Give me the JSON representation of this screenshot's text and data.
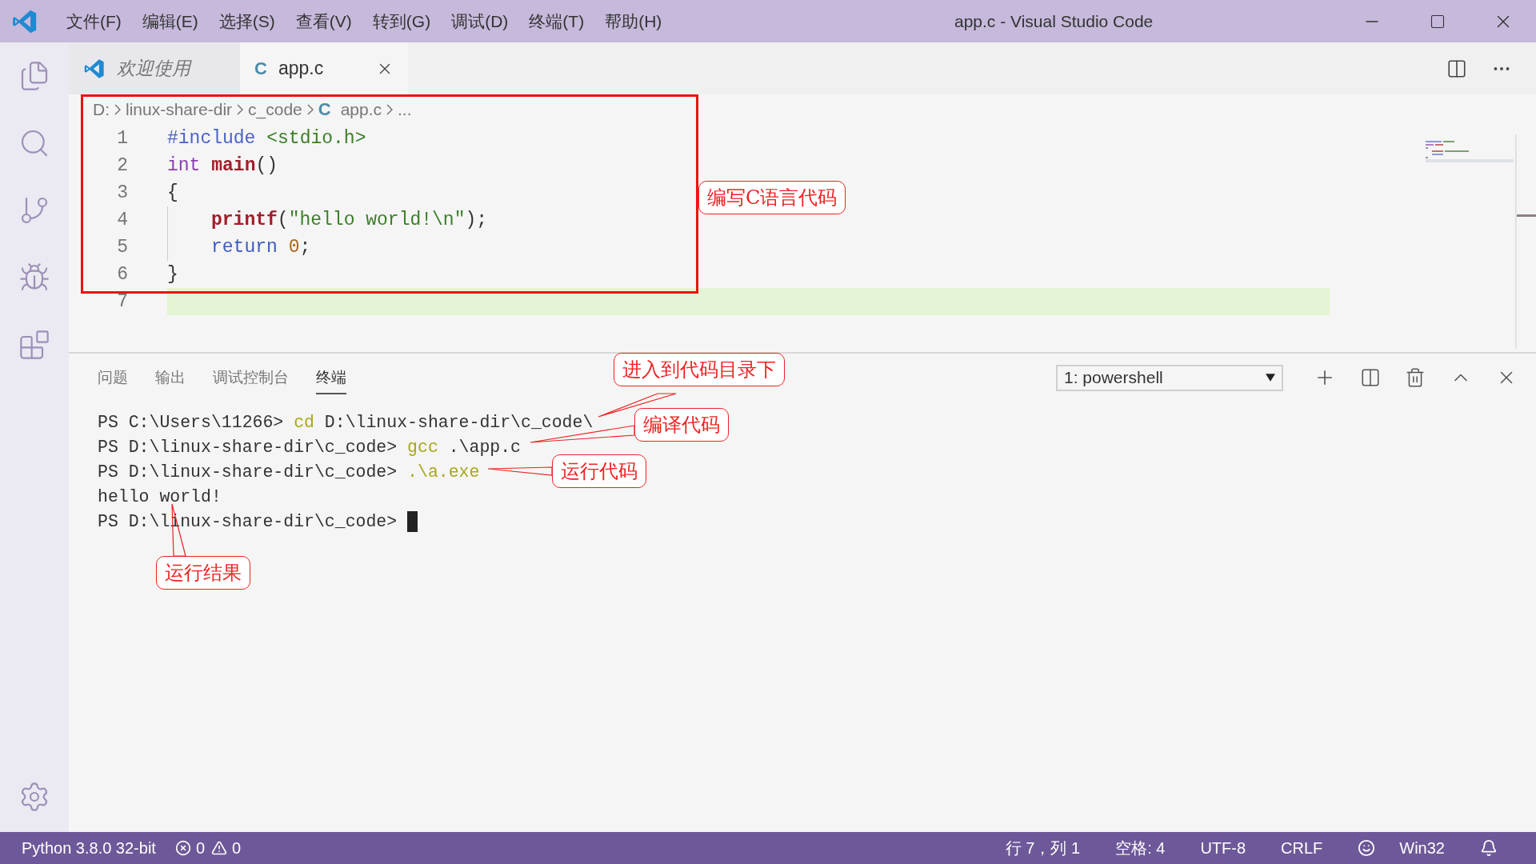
{
  "window": {
    "title": "app.c - Visual Studio Code"
  },
  "menu": [
    "文件(F)",
    "编辑(E)",
    "选择(S)",
    "查看(V)",
    "转到(G)",
    "调试(D)",
    "终端(T)",
    "帮助(H)"
  ],
  "tabs": [
    {
      "label": "欢迎使用",
      "kind": "welcome",
      "selected": false
    },
    {
      "label": "app.c",
      "kind": "source",
      "icon_text": "C",
      "selected": true
    }
  ],
  "breadcrumb": [
    {
      "label": "D:"
    },
    {
      "label": "linux-share-dir"
    },
    {
      "label": "c_code"
    },
    {
      "label": "app.c",
      "icon_text": "C"
    },
    {
      "label": "..."
    }
  ],
  "code": {
    "lines": [
      {
        "number": "1",
        "highlighted": false,
        "indent": false,
        "tokens": [
          {
            "kind": "directive",
            "text": "#include "
          },
          {
            "kind": "header",
            "text": "<stdio.h>"
          }
        ]
      },
      {
        "number": "2",
        "highlighted": false,
        "indent": false,
        "tokens": [
          {
            "kind": "type",
            "text": "int "
          },
          {
            "kind": "function",
            "text": "main"
          },
          {
            "kind": "plain",
            "text": "()"
          }
        ]
      },
      {
        "number": "3",
        "highlighted": false,
        "indent": false,
        "tokens": [
          {
            "kind": "plain",
            "text": "{"
          }
        ]
      },
      {
        "number": "4",
        "highlighted": false,
        "indent": true,
        "tokens": [
          {
            "kind": "function",
            "text": "printf"
          },
          {
            "kind": "plain",
            "text": "("
          },
          {
            "kind": "string",
            "text": "\"hello world!\\n\""
          },
          {
            "kind": "plain",
            "text": ");"
          }
        ]
      },
      {
        "number": "5",
        "highlighted": false,
        "indent": true,
        "tokens": [
          {
            "kind": "keyword",
            "text": "return "
          },
          {
            "kind": "number",
            "text": "0"
          },
          {
            "kind": "plain",
            "text": ";"
          }
        ]
      },
      {
        "number": "6",
        "highlighted": false,
        "indent": false,
        "tokens": [
          {
            "kind": "plain",
            "text": "}"
          }
        ]
      },
      {
        "number": "7",
        "highlighted": true,
        "indent": false
      }
    ]
  },
  "panel": {
    "tabs": [
      {
        "label": "问题",
        "selected": false
      },
      {
        "label": "输出",
        "selected": false
      },
      {
        "label": "调试控制台",
        "selected": false
      },
      {
        "label": "终端",
        "selected": true
      }
    ],
    "terminal_select": {
      "value": "1: powershell"
    },
    "terminal_lines": [
      {
        "cursor": false,
        "segments": [
          {
            "kind": "plain",
            "text": "PS C:\\Users\\11266> "
          },
          {
            "kind": "command",
            "text": "cd"
          },
          {
            "kind": "plain",
            "text": " D:\\linux-share-dir\\c_code\\"
          }
        ]
      },
      {
        "cursor": false,
        "segments": [
          {
            "kind": "plain",
            "text": "PS D:\\linux-share-dir\\c_code> "
          },
          {
            "kind": "command",
            "text": "gcc"
          },
          {
            "kind": "plain",
            "text": " .\\app.c"
          }
        ]
      },
      {
        "cursor": false,
        "segments": [
          {
            "kind": "plain",
            "text": "PS D:\\linux-share-dir\\c_code> "
          },
          {
            "kind": "command",
            "text": ".\\a.exe"
          }
        ]
      },
      {
        "cursor": false,
        "segments": [
          {
            "kind": "plain",
            "text": "hello world!"
          }
        ]
      },
      {
        "cursor": true,
        "segments": [
          {
            "kind": "plain",
            "text": "PS D:\\linux-share-dir\\c_code> "
          }
        ]
      }
    ]
  },
  "status_bar": {
    "left": [
      {
        "kind": "text",
        "text": "Python 3.8.0 32-bit"
      },
      {
        "kind": "error",
        "text": "0"
      },
      {
        "kind": "warning",
        "text": "0"
      }
    ],
    "right": [
      {
        "kind": "text",
        "text": "行 7，列 1"
      },
      {
        "kind": "text",
        "text": "空格: 4"
      },
      {
        "kind": "text",
        "text": "UTF-8"
      },
      {
        "kind": "text",
        "text": "CRLF"
      },
      {
        "kind": "feedback"
      },
      {
        "kind": "text",
        "text": "Win32"
      },
      {
        "kind": "bell"
      }
    ]
  },
  "callouts": [
    {
      "text": "编写C语言代码"
    },
    {
      "text": "进入到代码目录下"
    },
    {
      "text": "编译代码"
    },
    {
      "text": "运行代码"
    },
    {
      "text": "运行结果"
    }
  ]
}
